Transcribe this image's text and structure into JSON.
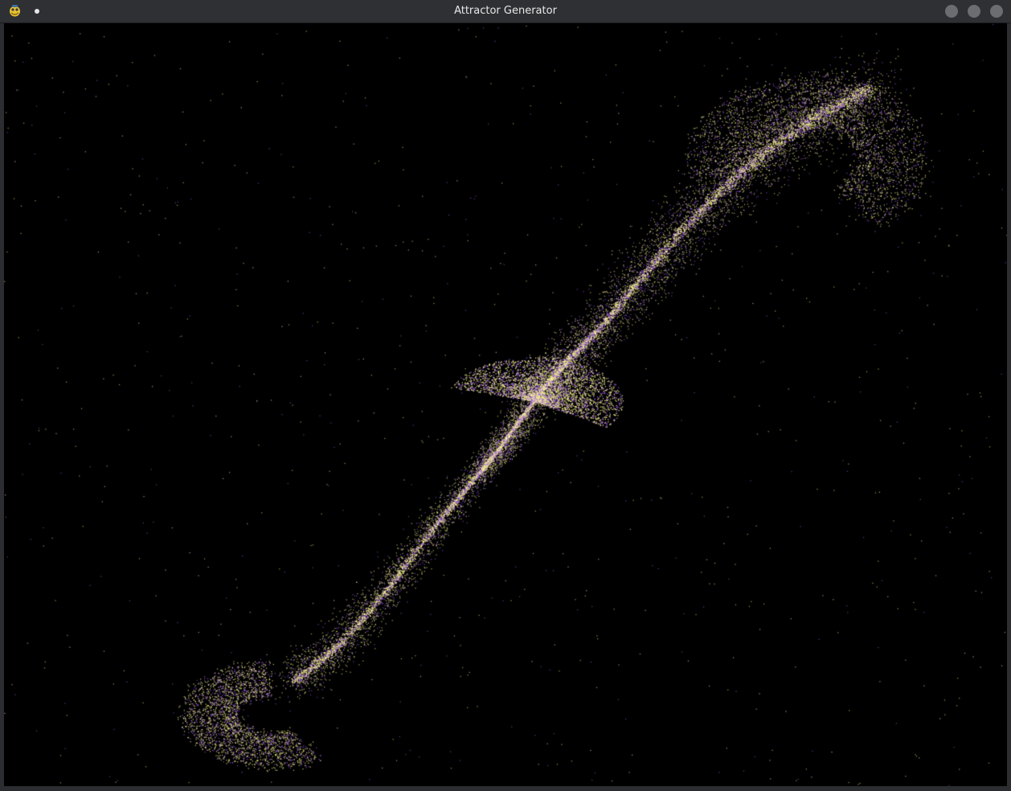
{
  "window": {
    "title": "Attractor Generator",
    "app_icon": "python-snake-icon",
    "menu_icon": "dot-menu-icon",
    "controls": [
      "minimize-icon",
      "maximize-icon",
      "close-icon"
    ]
  },
  "colors": {
    "background": "#000000",
    "titlebar": "#2f3034",
    "title_text": "#e8e8e8",
    "window_button": "#6c6d70",
    "point_yellow": "#f4f28a",
    "point_purple": "#9b59e6",
    "point_white": "#fff7c8"
  }
}
